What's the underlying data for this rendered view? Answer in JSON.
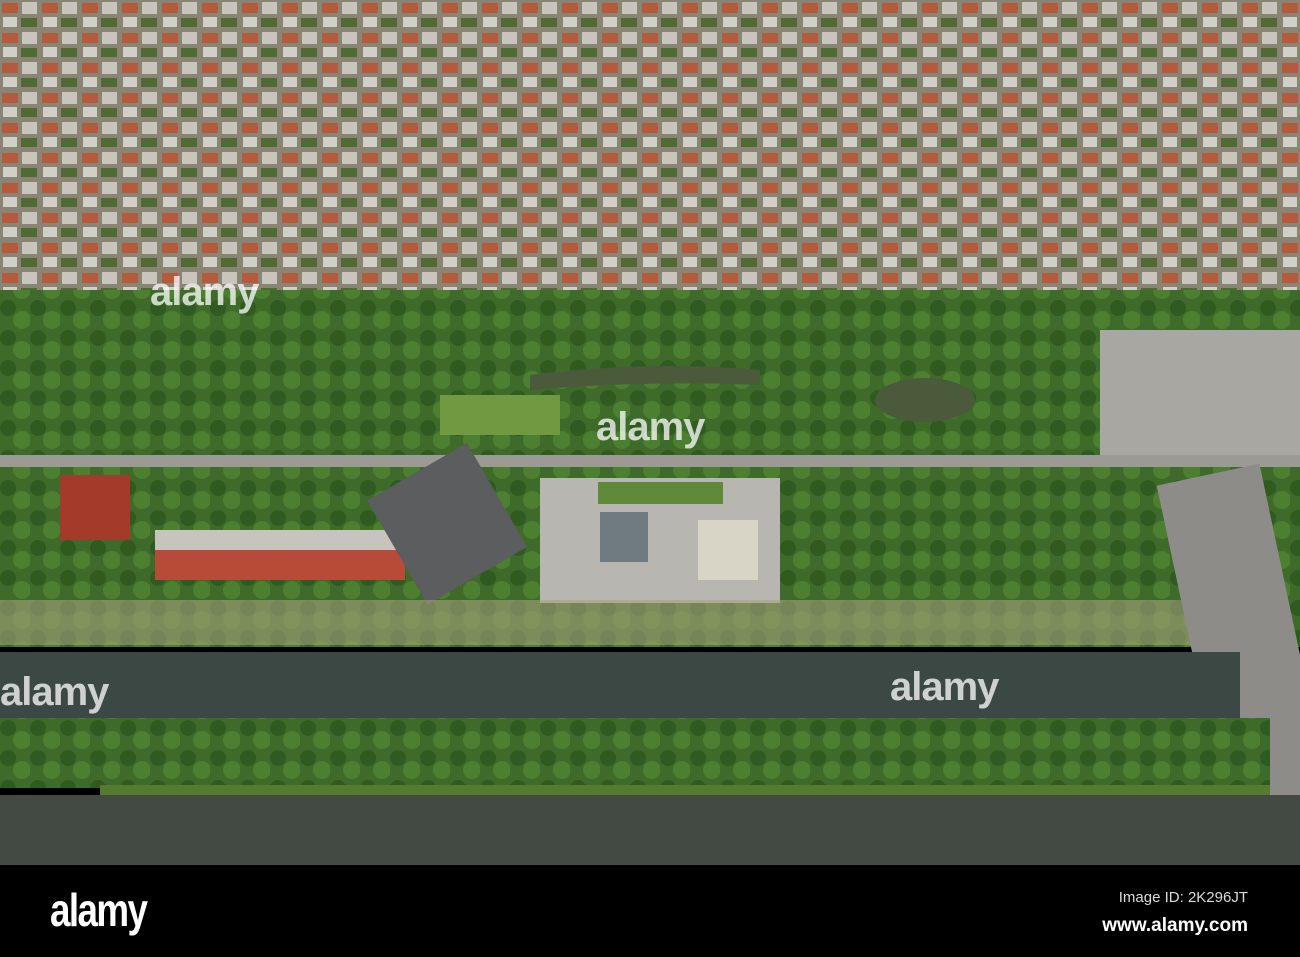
{
  "photo": {
    "subject": "aerial city view with river"
  },
  "watermarks": [
    "alamy",
    "alamy",
    "alamy",
    "alamy"
  ],
  "footer": {
    "logo": "alamy",
    "image_id": "Image ID: 2K296JT",
    "url": "www.alamy.com"
  }
}
